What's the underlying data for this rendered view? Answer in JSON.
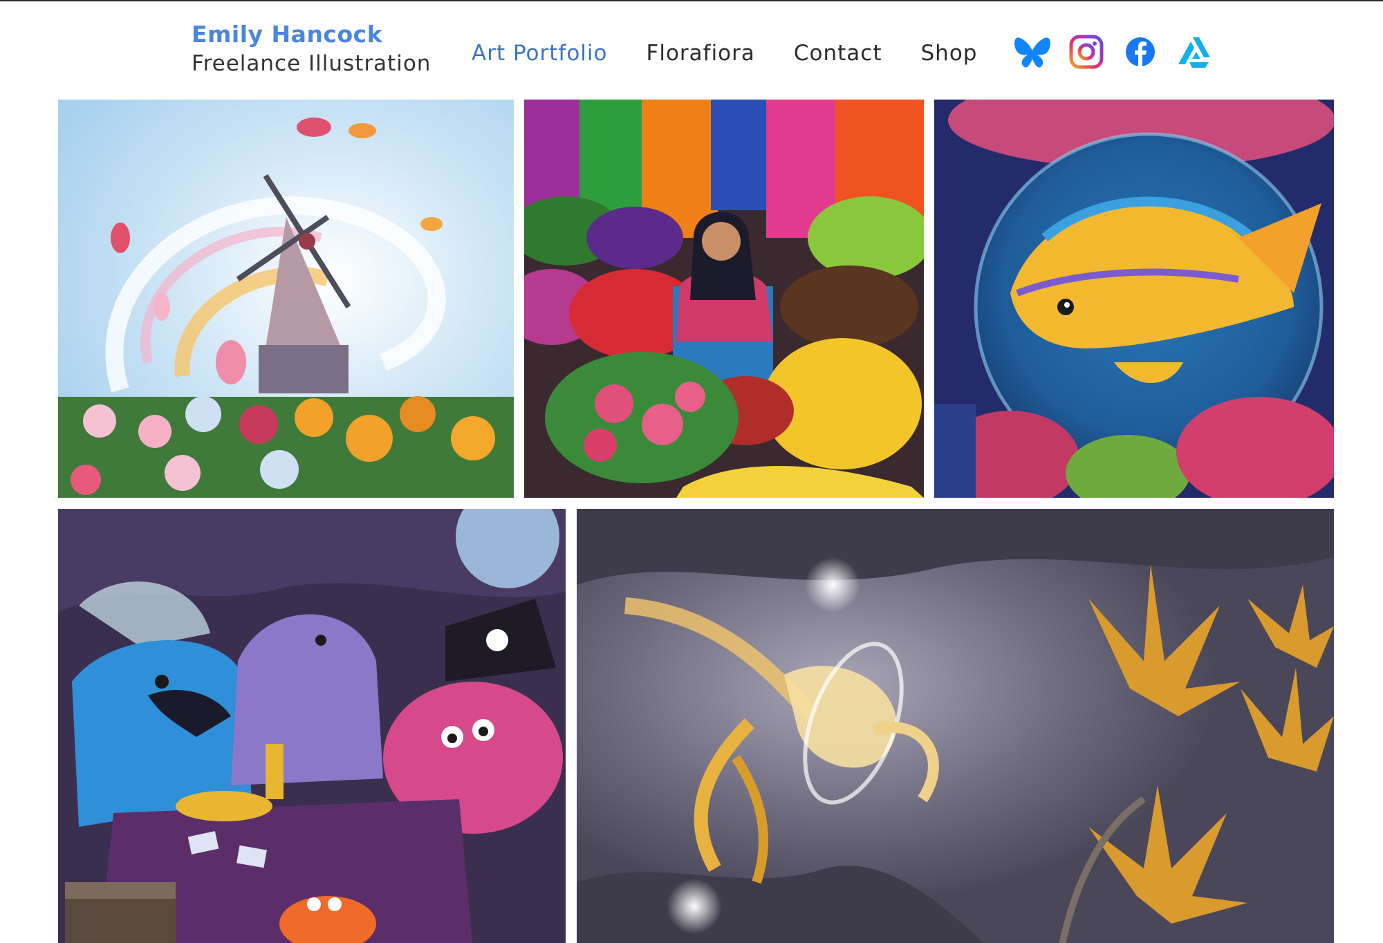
{
  "brand": {
    "name": "Emily Hancock",
    "tagline": "Freelance Illustration"
  },
  "nav": {
    "items": [
      {
        "label": "Art Portfolio",
        "active": true
      },
      {
        "label": "Florafiora",
        "active": false
      },
      {
        "label": "Contact",
        "active": false
      },
      {
        "label": "Shop",
        "active": false
      }
    ]
  },
  "social": [
    {
      "icon": "butterfly-icon",
      "color": "#1185fe"
    },
    {
      "icon": "instagram-icon",
      "color": "#e1306c"
    },
    {
      "icon": "facebook-icon",
      "color": "#1877f2"
    },
    {
      "icon": "artstation-icon",
      "color": "#13aff0"
    }
  ],
  "colors": {
    "brand": "#4a86dc",
    "nav_active": "#3b74c4",
    "nav_text": "#2b2b2b"
  },
  "gallery": [
    {
      "subject": "windmill and tulips"
    },
    {
      "subject": "market vendor with fruit"
    },
    {
      "subject": "golden fish in a bubble"
    },
    {
      "subject": "sea creatures playing cards"
    },
    {
      "subject": "golden spirit in a cave"
    }
  ]
}
